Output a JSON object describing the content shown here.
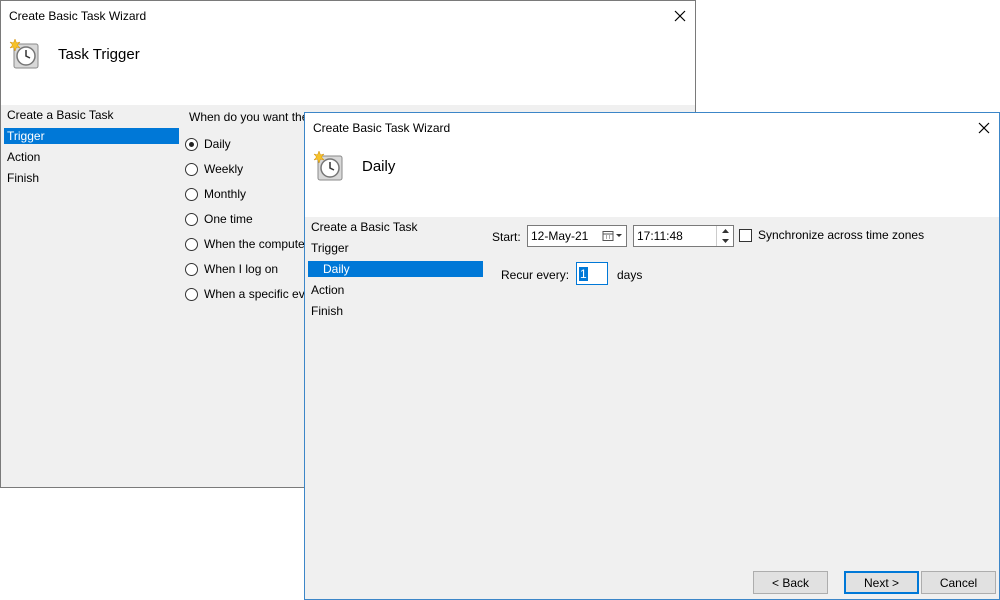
{
  "back_window": {
    "title": "Create Basic Task Wizard",
    "header_title": "Task Trigger",
    "nav": [
      "Create a Basic Task",
      "Trigger",
      "Action",
      "Finish"
    ],
    "question": "When do you want the",
    "options": [
      "Daily",
      "Weekly",
      "Monthly",
      "One time",
      "When the compute",
      "When I log on",
      "When a specific eve"
    ],
    "selected_option": "Daily"
  },
  "front_window": {
    "title": "Create Basic Task Wizard",
    "header_title": "Daily",
    "nav": [
      "Create a Basic Task",
      "Trigger",
      "Daily",
      "Action",
      "Finish"
    ],
    "start_label": "Start:",
    "start_date": "12-May-21",
    "start_time": "17:11:48",
    "sync_label": "Synchronize across time zones",
    "sync_checked": false,
    "recur_label": "Recur every:",
    "recur_value": "1",
    "recur_unit": "days",
    "buttons": {
      "back": "< Back",
      "next": "Next >",
      "cancel": "Cancel"
    }
  }
}
